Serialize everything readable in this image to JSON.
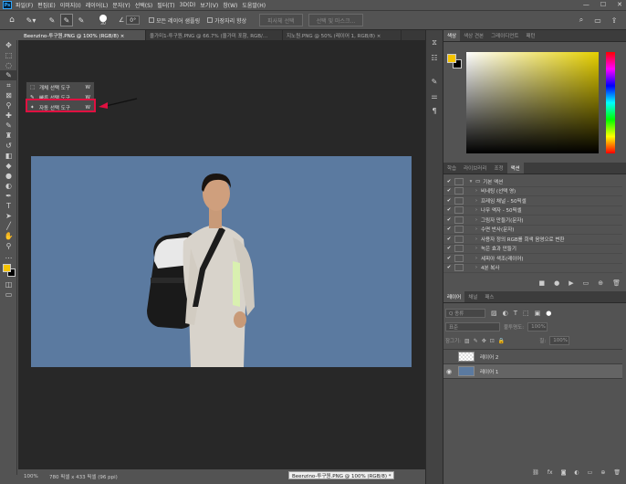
{
  "app": {
    "logo": "Ps"
  },
  "menu": [
    "파일(F)",
    "편집(E)",
    "이미지(I)",
    "레이어(L)",
    "문자(Y)",
    "선택(S)",
    "필터(T)",
    "3D(D)",
    "보기(V)",
    "창(W)",
    "도움말(H)"
  ],
  "window_controls": [
    "—",
    "☐",
    "✕"
  ],
  "options": {
    "brush_size": "30",
    "angle": "0°",
    "sample_all_layers": "모든 레이어 샘플링",
    "enhance_edge": "가장자리 향상",
    "select_subject": "피사체 선택",
    "select_and_mask": "선택 및 마스크..."
  },
  "tabs": [
    {
      "label": "Beenzino-투구원.PNG @ 100% (RGB/8) ×",
      "active": true
    },
    {
      "label": "올가미1-투구원.PNG @ 66.7% (올가미 포함, RGB/...",
      "active": false
    },
    {
      "label": "지노원.PNG @ 50% (레이어 1, RGB/8) ×",
      "active": false
    }
  ],
  "flyout": [
    {
      "label": "개체 선택 도구",
      "key": "W"
    },
    {
      "label": "빠른 선택 도구",
      "key": "W"
    },
    {
      "label": "자동 선택 도구",
      "key": "W"
    }
  ],
  "status": {
    "zoom": "100%",
    "size": "780 픽셀 x 433 픽셀 (96 ppi)",
    "doc_label": "Beenzino-투구원.PNG @ 100% (RGB/8) *"
  },
  "color_panel": {
    "tabs": [
      "색상",
      "색상 견본",
      "그레이디언트",
      "패턴"
    ],
    "foreground": "#f5c400",
    "background": "#000000"
  },
  "actions_panel": {
    "tabs": [
      "학습",
      "라이브러리",
      "조정",
      "액션"
    ],
    "rows": [
      "기본 액션",
      "비네팅 (선택 영)",
      "프레임 채널 - 50픽셀",
      "나무 액자 - 50픽셀",
      "그림자 만들기(문자)",
      "수면 반사(문자)",
      "사용자 정의 RGB를 회색 음영으로 변환",
      "녹은 효과 만들기",
      "세피아 색조(레이어)",
      "4분 복사"
    ]
  },
  "layers_panel": {
    "tabs": [
      "레이어",
      "채널",
      "패스"
    ],
    "kind": "Q 종류",
    "blend": "표준",
    "opacity_label": "불투명도:",
    "opacity": "100%",
    "lock_label": "잠그기:",
    "fill_label": "칠:",
    "fill": "100%",
    "layers": [
      {
        "name": "레이어 2",
        "visible": false
      },
      {
        "name": "레이어 1",
        "visible": true
      }
    ]
  }
}
